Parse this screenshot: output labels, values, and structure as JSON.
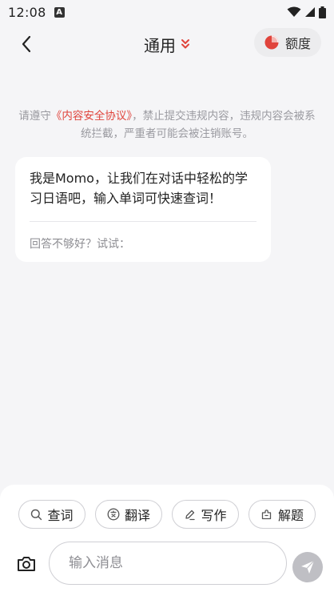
{
  "status_bar": {
    "time": "12:08",
    "notification_icon": "font-a-icon",
    "icons": [
      "wifi-icon",
      "signal-icon",
      "battery-icon"
    ]
  },
  "header": {
    "title": "通用",
    "title_dropdown_icon": "double-chevron-down-icon",
    "quota_label": "额度",
    "quota_icon": "pie-chart-icon",
    "accent_color": "#e0443c"
  },
  "notice": {
    "prefix": "请遵守",
    "link_text": "《内容安全协议》",
    "suffix": "，禁止提交违规内容，违规内容会被系统拦截，严重者可能会被注销账号。"
  },
  "bot_message": {
    "text": "我是Momo，让我们在对话中轻松的学习日语吧，输入单词可快速查词！",
    "footer": "回答不够好？试试："
  },
  "quick_actions": [
    {
      "label": "查词",
      "icon": "search-icon"
    },
    {
      "label": "翻译",
      "icon": "translate-icon"
    },
    {
      "label": "写作",
      "icon": "pen-icon"
    },
    {
      "label": "解题",
      "icon": "puzzle-icon"
    }
  ],
  "composer": {
    "placeholder": "输入消息",
    "camera_icon": "camera-icon",
    "send_icon": "send-icon"
  }
}
